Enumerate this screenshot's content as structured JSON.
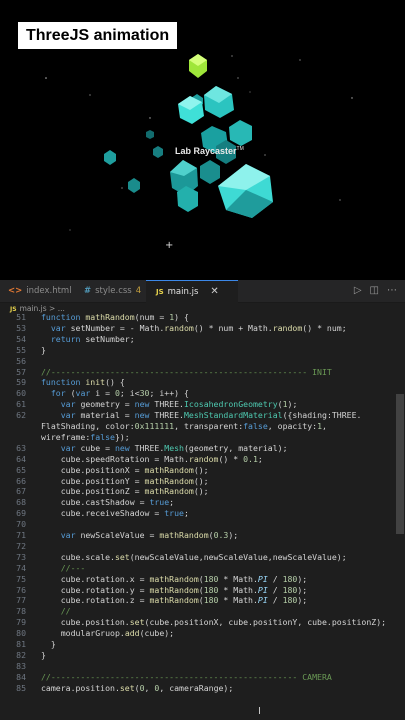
{
  "overlay_title": "ThreeJS animation",
  "scene": {
    "label": "Lab Raycaster",
    "label_mark": "TM",
    "cursor": "+"
  },
  "editor": {
    "tabs": [
      {
        "icon": "<>",
        "label": "index.html",
        "badge": "",
        "active": false
      },
      {
        "icon": "#",
        "label": "style.css",
        "badge": "4",
        "active": false
      },
      {
        "icon": "JS",
        "label": "main.js",
        "badge": "",
        "active": true,
        "close": "✕"
      }
    ],
    "actions": [
      "▷",
      "◫",
      "⋯"
    ],
    "breadcrumb_icon": "JS",
    "breadcrumb": "main.js > ...",
    "lines": [
      {
        "n": "51",
        "t": "function mathRandom(num = 1) {"
      },
      {
        "n": "53",
        "t": "  var setNumber = - Math.random() * num + Math.random() * num;"
      },
      {
        "n": "54",
        "t": "  return setNumber;"
      },
      {
        "n": "55",
        "t": "}"
      },
      {
        "n": "56",
        "t": ""
      },
      {
        "n": "57",
        "t": "//---------------------------------------------------- INIT"
      },
      {
        "n": "59",
        "t": "function init() {"
      },
      {
        "n": "60",
        "t": "  for (var i = 0; i<30; i++) {"
      },
      {
        "n": "61",
        "t": "    var geometry = new THREE.IcosahedronGeometry(1);"
      },
      {
        "n": "62",
        "t": "    var material = new THREE.MeshStandardMaterial({shading:THREE."
      },
      {
        "n": "",
        "t": "FlatShading, color:0x111111, transparent:false, opacity:1,"
      },
      {
        "n": "",
        "t": "wireframe:false});"
      },
      {
        "n": "63",
        "t": "    var cube = new THREE.Mesh(geometry, material);"
      },
      {
        "n": "64",
        "t": "    cube.speedRotation = Math.random() * 0.1;"
      },
      {
        "n": "65",
        "t": "    cube.positionX = mathRandom();"
      },
      {
        "n": "66",
        "t": "    cube.positionY = mathRandom();"
      },
      {
        "n": "67",
        "t": "    cube.positionZ = mathRandom();"
      },
      {
        "n": "68",
        "t": "    cube.castShadow = true;"
      },
      {
        "n": "69",
        "t": "    cube.receiveShadow = true;"
      },
      {
        "n": "70",
        "t": ""
      },
      {
        "n": "71",
        "t": "    var newScaleValue = mathRandom(0.3);"
      },
      {
        "n": "72",
        "t": ""
      },
      {
        "n": "73",
        "t": "    cube.scale.set(newScaleValue,newScaleValue,newScaleValue);"
      },
      {
        "n": "74",
        "t": "    //---"
      },
      {
        "n": "75",
        "t": "    cube.rotation.x = mathRandom(180 * Math.PI / 180);"
      },
      {
        "n": "76",
        "t": "    cube.rotation.y = mathRandom(180 * Math.PI / 180);"
      },
      {
        "n": "77",
        "t": "    cube.rotation.z = mathRandom(180 * Math.PI / 180);"
      },
      {
        "n": "78",
        "t": "    //"
      },
      {
        "n": "79",
        "t": "    cube.position.set(cube.positionX, cube.positionY, cube.positionZ);"
      },
      {
        "n": "80",
        "t": "    modularGruop.add(cube);"
      },
      {
        "n": "81",
        "t": "  }"
      },
      {
        "n": "82",
        "t": "}"
      },
      {
        "n": "83",
        "t": ""
      },
      {
        "n": "84",
        "t": "//-------------------------------------------------- CAMERA"
      },
      {
        "n": "85",
        "t": "camera.position.set(0, 0, cameraRange);"
      }
    ]
  },
  "colors": {
    "teal": "#2ec4c4",
    "lime": "#b8f24a",
    "editor_bg": "#1e1e1e"
  }
}
